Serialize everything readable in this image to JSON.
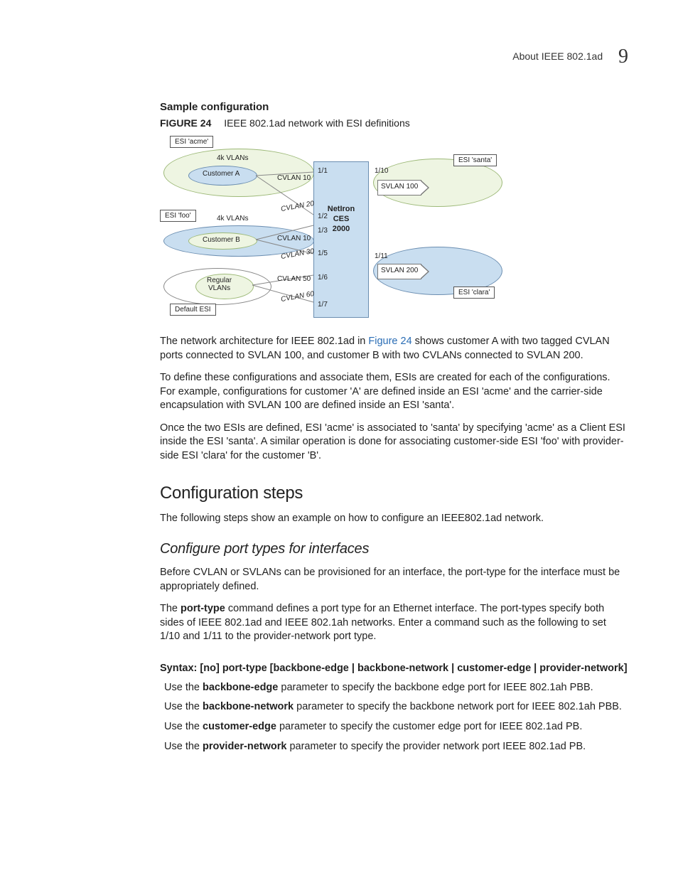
{
  "header": {
    "title": "About IEEE 802.1ad",
    "chapter": "9"
  },
  "sample_conf": "Sample configuration",
  "figure": {
    "label": "FIGURE 24",
    "caption": "IEEE 802.1ad network with ESI definitions",
    "esi_acme": "ESI 'acme'",
    "esi_foo": "ESI 'foo'",
    "esi_santa": "ESI 'santa'",
    "esi_clara": "ESI 'clara'",
    "default_esi": "Default ESI",
    "cust_a": "Customer A",
    "cust_b": "Customer B",
    "reg_vlans": "Regular\nVLANs",
    "k4a": "4k VLANs",
    "k4b": "4k VLANs",
    "cvlan10": "CVLAN 10",
    "cvlan20": "CVLAN 20",
    "cvlan10b": "CVLAN 10",
    "cvlan30": "CVLAN 30",
    "cvlan50": "CVLAN 50",
    "cvlan60": "CVLAN 60",
    "svlan100": "SVLAN 100",
    "svlan200": "SVLAN 200",
    "switch_name": "NetIron\nCES\n2000",
    "p11": "1/1",
    "p12": "1/2",
    "p13": "1/3",
    "p15": "1/5",
    "p16": "1/6",
    "p17": "1/7",
    "p110": "1/10",
    "p111": "1/11"
  },
  "p1a": "The network architecture for IEEE 802.1ad in ",
  "fig_link": "Figure 24",
  "p1b": " shows customer A with two tagged CVLAN ports connected to SVLAN 100, and customer B with two CVLANs connected to SVLAN 200.",
  "p2": "To define these configurations and associate them, ESIs are created for each of the configurations. For example, configurations for customer 'A' are defined inside an ESI 'acme' and the carrier-side encapsulation with SVLAN 100 are defined inside an ESI 'santa'.",
  "p3": "Once the two ESIs are defined, ESI 'acme' is associated to 'santa' by specifying 'acme' as a Client ESI inside the ESI 'santa'. A similar operation is done for associating customer-side ESI 'foo' with provider-side ESI 'clara' for the customer 'B'.",
  "h2": "Configuration steps",
  "p4": "The following steps show an example on how to configure an IEEE802.1ad network.",
  "h3": "Configure port types for interfaces",
  "p5": "Before CVLAN or SVLANs can be provisioned for an interface, the port-type for the interface must be appropriately defined.",
  "p6a": "The ",
  "p6b": "port-type",
  "p6c": " command defines a port type for an Ethernet interface. The port-types specify both sides of IEEE 802.1ad and IEEE 802.1ah networks. Enter a command such as the following to set 1/10 and 1/11 to the provider-network port type.",
  "syntax": {
    "lead": "Syntax:  ",
    "body": "[no] port-type [backbone-edge | backbone-network | customer-edge | provider-network]"
  },
  "params": {
    "be_a": "Use the ",
    "be_b": "backbone-edge",
    "be_c": " parameter to specify the backbone edge port for IEEE 802.1ah PBB.",
    "bn_a": "Use the ",
    "bn_b": "backbone-network",
    "bn_c": " parameter to specify the backbone network port for IEEE 802.1ah PBB.",
    "ce_a": "Use the ",
    "ce_b": "customer-edge",
    "ce_c": " parameter to specify the customer edge port for IEEE 802.1ad PB.",
    "pn_a": "Use the ",
    "pn_b": "provider-network",
    "pn_c": " parameter to specify the provider network port IEEE 802.1ad PB."
  }
}
